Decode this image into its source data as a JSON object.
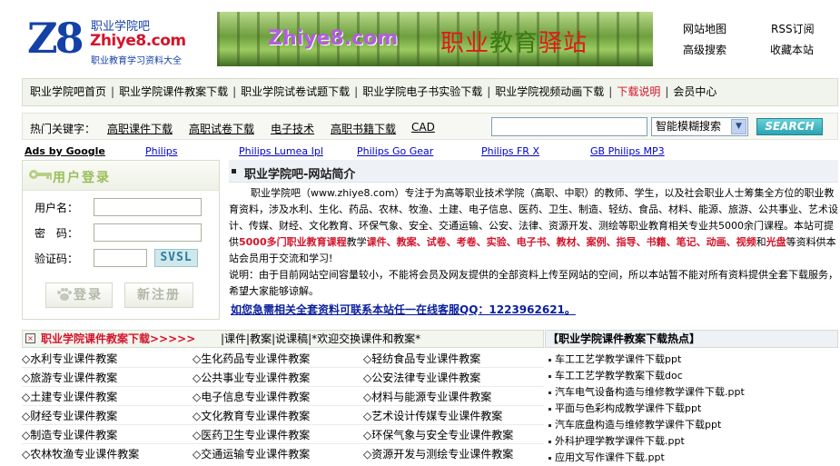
{
  "header": {
    "logo": {
      "mark": "Z8",
      "cn": "职业学院吧",
      "en": "Zhiye8.com",
      "sub": "职业教育学习资料大全"
    },
    "banner": {
      "site": "Zhiye8.com",
      "slogan_a": "职业",
      "slogan_b": "教育",
      "slogan_c": "驿站"
    },
    "links": [
      "网站地图",
      "RSS订阅",
      "高级搜索",
      "收藏本站"
    ]
  },
  "nav": {
    "items": [
      "职业学院吧首页",
      "职业学院课件教案下载",
      "职业学院试卷试题下载",
      "职业学院电子书实验下载",
      "职业学院视频动画下载",
      "下载说明",
      "会员中心"
    ],
    "highlight_color": "#d4142a"
  },
  "search": {
    "hot_label": "热门关键字：",
    "keywords": [
      "高职课件下载",
      "高职试卷下载",
      "电子技术",
      "高职书籍下载",
      "CAD"
    ],
    "input_value": "",
    "select_value": "智能模糊搜索",
    "button_label": "SEARCH"
  },
  "ads": {
    "label": "Ads by Google",
    "links": [
      "Philips",
      "Philips Lumea Ipl",
      "Philips Go Gear",
      "Philips FR X",
      "GB Philips MP3"
    ]
  },
  "login": {
    "title": "用户登录",
    "username_label": "用户名：",
    "password_label": "密　码：",
    "captcha_label": "验证码：",
    "captcha_text": "SVSL",
    "login_button": "登录",
    "register_button": "新注册"
  },
  "intro": {
    "title": "职业学院吧-网站简介",
    "p1_a": "职业学院吧（www.zhiye8.com）专注于为高等职业技术学院（高职、中职）的教师、学生，以及社会职业人士筹集全方位的职业教育资料，涉及水利、生化、药品、农林、牧渔、土建、电子信息、医药、卫生、制造、轻纺、食品、材料、能源、旅游、公共事业、艺术设计、传媒、财经、文化教育、环保气象、安全、交通运输、公安、法律、资源开发、测绘等职业教育相关专业共5000余门课程。本站可提供",
    "p1_hl1": "5000多门职业教育课程",
    "p1_b": "教学",
    "p1_hl2": "课件、教案、试卷、考卷、实验、电子书、教材、案例、指导、书籍、笔记、动画、视频",
    "p1_c": "和",
    "p1_hl3": "光盘",
    "p1_d": "等资料供本站会员用于交流和学习!",
    "p2": "说明：由于目前网站空间容量较小，不能将会员及网友提供的全部资料上传至网站的空间，所以本站暂不能对所有资料提供全套下载服务，希望大家能够谅解。",
    "qq_line": "如您急需相关全套资料可联系本站任一在线客服QQ：1223962621。"
  },
  "courseware": {
    "title": "职业学院课件教案下载>>>>>",
    "subtitle": "|课件|教案|说课稿|*欢迎交换课件和教案*",
    "items": [
      [
        "◇水利专业课件教案",
        "◇生化药品专业课件教案",
        "◇轻纺食品专业课件教案"
      ],
      [
        "◇旅游专业课件教案",
        "◇公共事业专业课件教案",
        "◇公安法律专业课件教案"
      ],
      [
        "◇土建专业课件教案",
        "◇电子信息专业课件教案",
        "◇材料与能源专业课件教案"
      ],
      [
        "◇财经专业课件教案",
        "◇文化教育专业课件教案",
        "◇艺术设计传媒专业课件教案"
      ],
      [
        "◇制造专业课件教案",
        "◇医药卫生专业课件教案",
        "◇环保气象与安全专业课件教案"
      ],
      [
        "◇农林牧渔专业课件教案",
        "◇交通运输专业课件教案",
        "◇资源开发与测绘专业课件教案"
      ]
    ]
  },
  "hot": {
    "title": "【职业学院课件教案下载热点】",
    "items": [
      "车工工艺学教学课件下载ppt",
      "车工工艺学教学教案下载doc",
      "汽车电气设备构造与维修教学课件下载.ppt",
      "平面与色彩构成教学课件下载ppt",
      "汽车底盘构造与维修教学课件下载ppt",
      "外科护理学教学课件下载.ppt",
      "应用文写作课件下载.ppt"
    ]
  }
}
